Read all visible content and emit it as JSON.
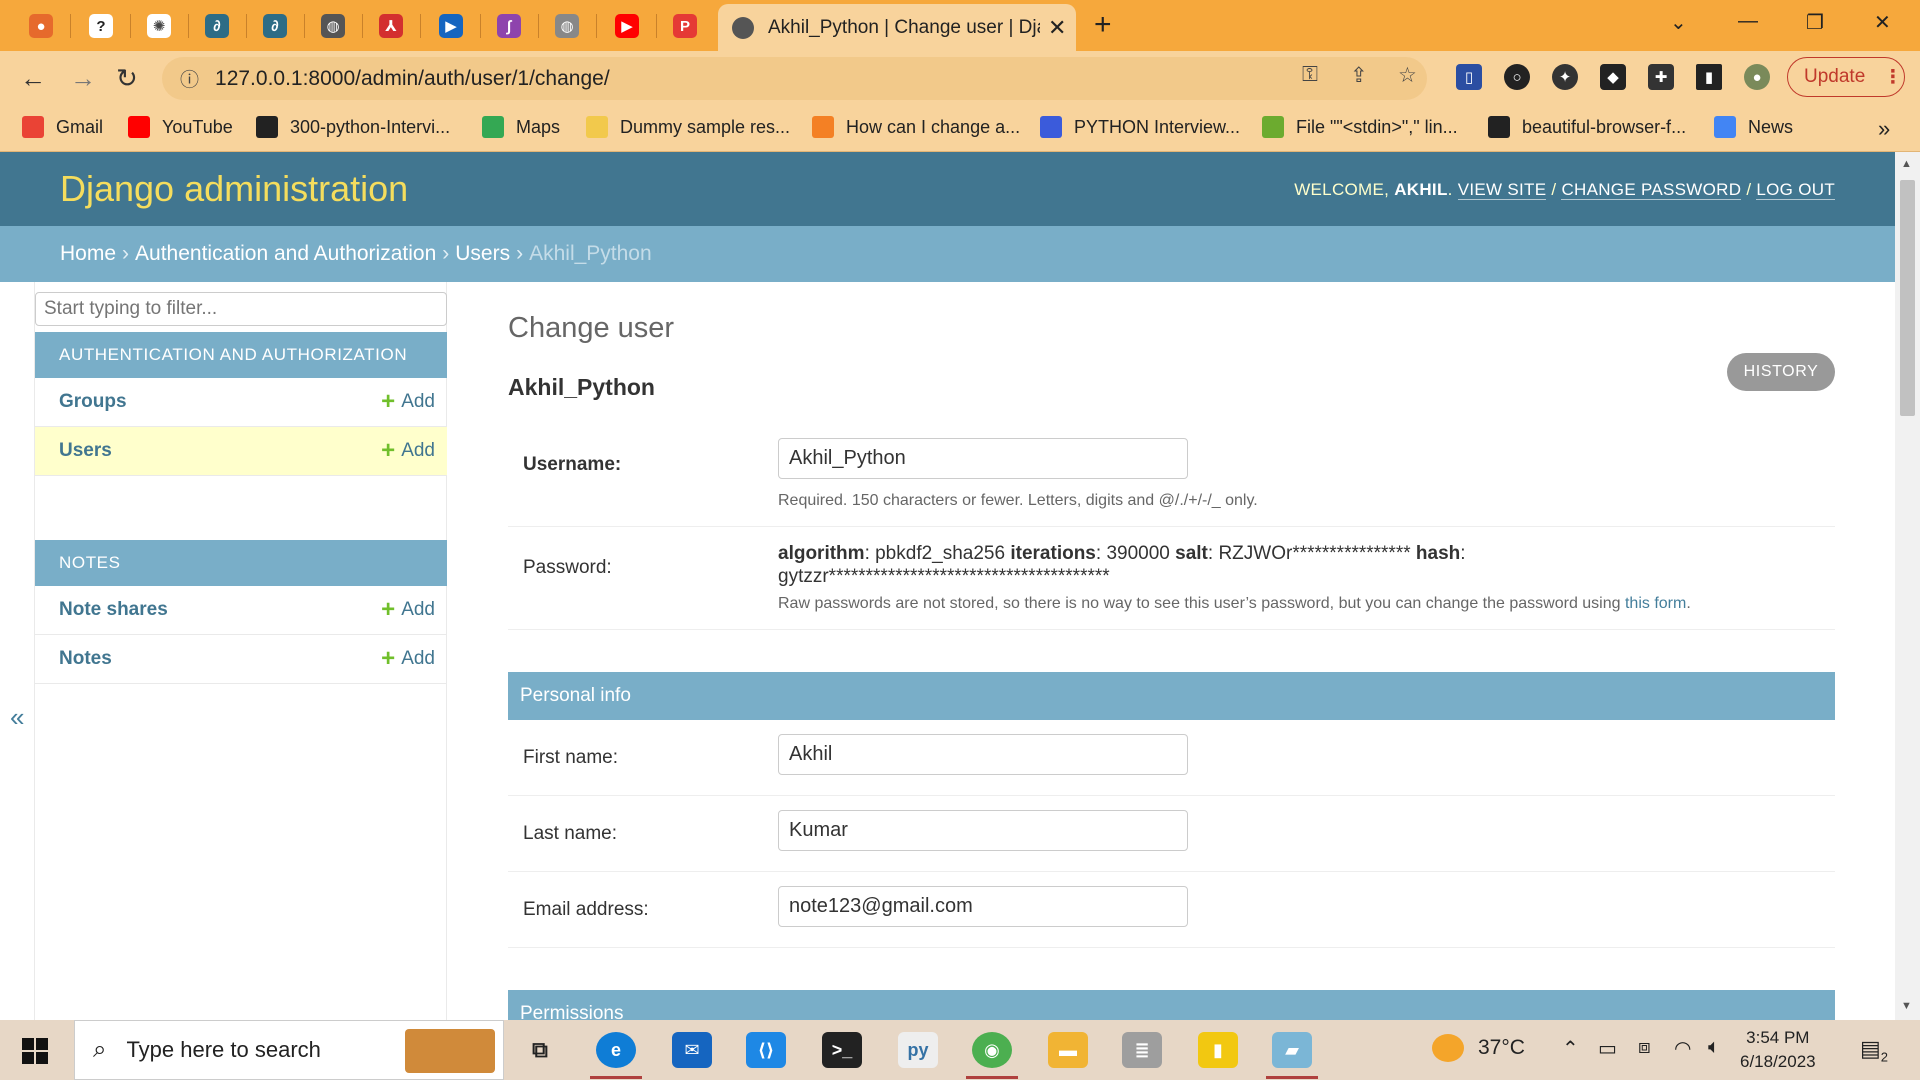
{
  "browser": {
    "active_tab_title": "Akhil_Python | Change user | Djan",
    "url": "127.0.0.1:8000/admin/auth/user/1/change/",
    "update_label": "Update",
    "bookmarks": [
      {
        "label": "Gmail",
        "icon": "gmail-icon",
        "color": "#ea4335"
      },
      {
        "label": "YouTube",
        "icon": "youtube-icon",
        "color": "#ff0000"
      },
      {
        "label": "300-python-Intervi...",
        "icon": "github-icon",
        "color": "#222222"
      },
      {
        "label": "Maps",
        "icon": "maps-icon",
        "color": "#34a853"
      },
      {
        "label": "Dummy sample res...",
        "icon": "document-icon",
        "color": "#f2c94c"
      },
      {
        "label": "How can I change a...",
        "icon": "stackoverflow-icon",
        "color": "#f48024"
      },
      {
        "label": "PYTHON Interview...",
        "icon": "wix-icon",
        "color": "#3b5bdb"
      },
      {
        "label": "File \"\"<stdin>\",\" lin...",
        "icon": "tool-icon",
        "color": "#6cab2f"
      },
      {
        "label": "beautiful-browser-f...",
        "icon": "checkbox-icon",
        "color": "#222222"
      },
      {
        "label": "News",
        "icon": "google-news-icon",
        "color": "#4285f4"
      }
    ]
  },
  "header": {
    "branding": "Django administration",
    "welcome": "WELCOME,",
    "username": "AKHIL",
    "view_site": "VIEW SITE",
    "change_password": "CHANGE PASSWORD",
    "log_out": "LOG OUT"
  },
  "breadcrumbs": {
    "home": "Home",
    "app": "Authentication and Authorization",
    "model": "Users",
    "current": "Akhil_Python"
  },
  "sidebar": {
    "filter_placeholder": "Start typing to filter...",
    "modules": [
      {
        "caption": "AUTHENTICATION AND AUTHORIZATION",
        "models": [
          {
            "name": "Groups",
            "add": "Add"
          },
          {
            "name": "Users",
            "add": "Add"
          }
        ]
      },
      {
        "caption": "NOTES",
        "models": [
          {
            "name": "Note shares",
            "add": "Add"
          },
          {
            "name": "Notes",
            "add": "Add"
          }
        ]
      }
    ],
    "toggle": "«"
  },
  "content": {
    "title": "Change user",
    "object_name": "Akhil_Python",
    "history": "HISTORY",
    "username_label": "Username:",
    "username_value": "Akhil_Python",
    "username_help": "Required. 150 characters or fewer. Letters, digits and @/./+/-/_ only.",
    "password_label": "Password:",
    "pw_algorithm_key": "algorithm",
    "pw_algorithm_val": ": pbkdf2_sha256 ",
    "pw_iterations_key": "iterations",
    "pw_iterations_val": ": 390000 ",
    "pw_salt_key": "salt",
    "pw_salt_val": ": RZJWOr**************** ",
    "pw_hash_key": "hash",
    "pw_hash_val": ": gytzzr**************************************",
    "pw_help_prefix": "Raw passwords are not stored, so there is no way to see this user’s password, but you can change the password using ",
    "pw_help_link": "this form",
    "pw_help_suffix": ".",
    "personal_info": "Personal info",
    "first_name_label": "First name:",
    "first_name_value": "Akhil",
    "last_name_label": "Last name:",
    "last_name_value": "Kumar",
    "email_label": "Email address:",
    "email_value": "note123@gmail.com",
    "permissions": "Permissions"
  },
  "taskbar": {
    "search_text": "Type here to search",
    "weather": "37°C",
    "time": "3:54 PM",
    "date": "6/18/2023",
    "notifications": "2"
  },
  "colors": {
    "tabbar": "#f6a83c",
    "django_header": "#417690",
    "django_breadcrumb": "#79aec8",
    "branding": "#f5dd5d",
    "link": "#417690",
    "add_plus": "#70bf2b"
  }
}
